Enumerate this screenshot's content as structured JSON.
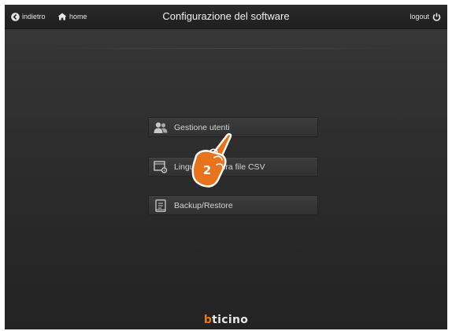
{
  "header": {
    "back_label": "indietro",
    "home_label": "home",
    "title": "Configurazione del software",
    "logout_label": "logout"
  },
  "menu": {
    "items": [
      {
        "label": "Gestione utenti",
        "icon": "users-icon"
      },
      {
        "label": "Lingua di lettura file CSV",
        "icon": "csv-settings-icon"
      },
      {
        "label": "Backup/Restore",
        "icon": "backup-icon"
      }
    ]
  },
  "callout": {
    "step_number": "2",
    "icon": "pointing-hand-icon",
    "color": "#e8731a"
  },
  "footer": {
    "logo_first": "b",
    "logo_rest": "ticino",
    "brand_color": "#e37b1d"
  }
}
